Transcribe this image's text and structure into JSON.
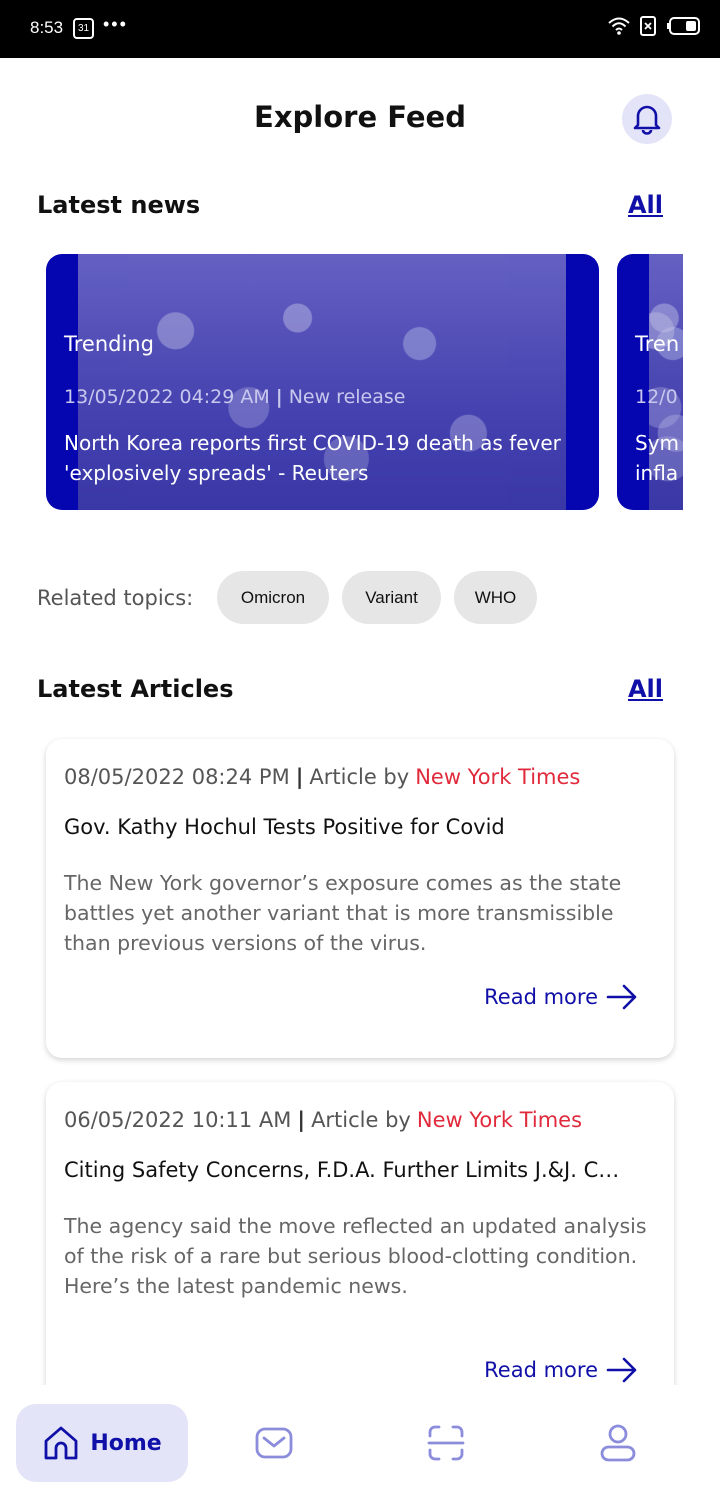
{
  "status_bar": {
    "time": "8:53",
    "calendar_day": "31",
    "dots": "•••"
  },
  "header": {
    "title": "Explore Feed"
  },
  "latest_news": {
    "title": "Latest news",
    "all_label": "All",
    "cards": [
      {
        "tag": "Trending",
        "date": "13/05/2022 04:29 AM",
        "type": "New release",
        "headline": "North Korea reports first COVID-19 death as fever 'explosively spreads' - Reuters"
      },
      {
        "tag": "Tren",
        "date": "12/0",
        "headline": "Sym infla"
      }
    ]
  },
  "topics": {
    "label": "Related topics:",
    "chips": [
      "Omicron",
      "Variant",
      "WHO"
    ]
  },
  "latest_articles": {
    "title": "Latest Articles",
    "all_label": "All",
    "articles": [
      {
        "date": "08/05/2022 08:24 PM",
        "by": "Article by",
        "source": "New York Times",
        "title": "Gov. Kathy Hochul Tests Positive for Covid",
        "desc": "The New York governor’s exposure comes as the state battles yet another variant that is more transmissible than previous versions of the virus.",
        "read_more": "Read more"
      },
      {
        "date": "06/05/2022 10:11 AM",
        "by": "Article by",
        "source": "New York Times",
        "title": "Citing Safety Concerns, F.D.A. Further Limits J.&J. C…",
        "desc": "The agency said the move reflected an updated analysis of the risk of a rare but serious blood-clotting condition. Here’s the latest pandemic news.",
        "read_more": "Read more"
      }
    ]
  },
  "bottom_nav": {
    "home_label": "Home"
  },
  "colors": {
    "accent": "#1010a8",
    "card_bg": "#0606b0",
    "source_red": "#e02a3c",
    "chip_bg": "#e6e6e6"
  }
}
